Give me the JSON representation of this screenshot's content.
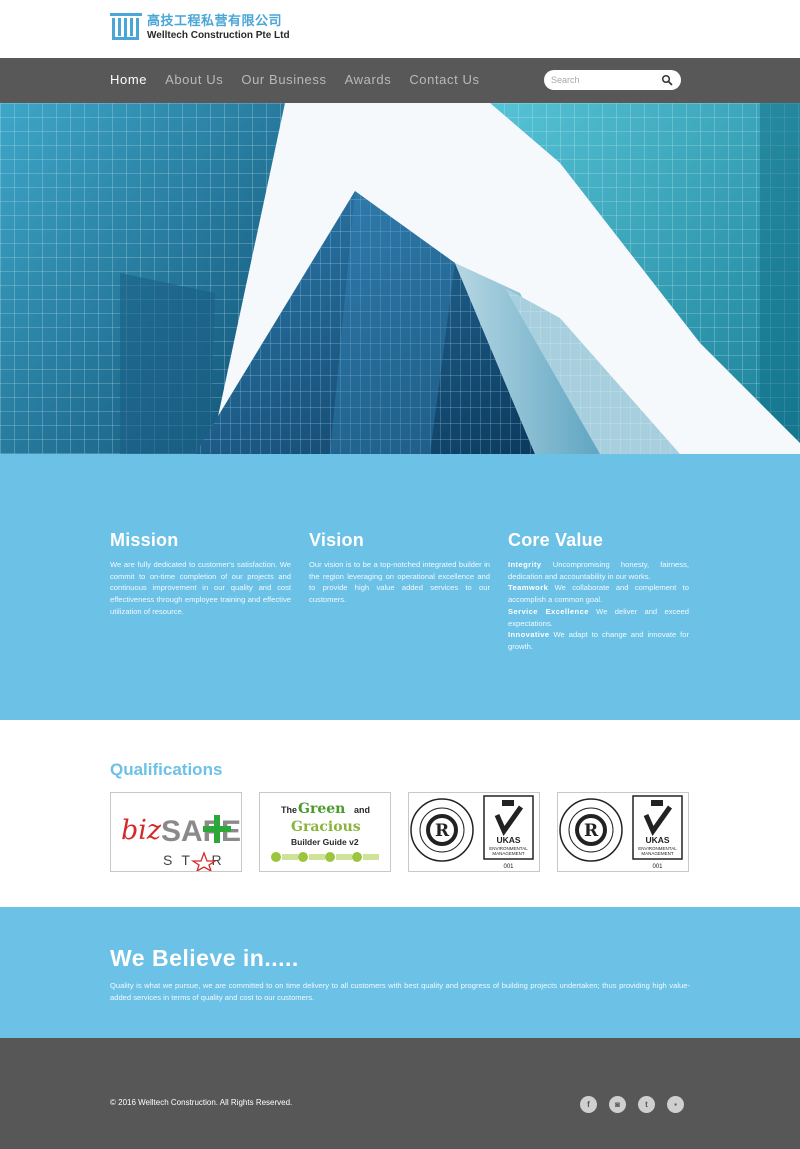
{
  "brand": {
    "name_cn": "高技工程私营有限公司",
    "name_en": "Welltech Construction Pte Ltd",
    "color_primary": "#4aa6d6"
  },
  "nav": {
    "items": [
      {
        "label": "Home",
        "active": true
      },
      {
        "label": "About Us",
        "active": false
      },
      {
        "label": "Our Business",
        "active": false
      },
      {
        "label": "Awards",
        "active": false
      },
      {
        "label": "Contact Us",
        "active": false
      }
    ],
    "search_placeholder": "Search",
    "search_icon": "search-icon"
  },
  "hero": {
    "image": "glass skyscrapers viewed from below"
  },
  "mission": {
    "title": "Mission",
    "text": "We are fully dedicated to customer's satisfaction. We commit to on-time completion of our projects and continuous improvement in our quality and cost effectiveness through employee training and effective utilization of resource."
  },
  "vision": {
    "title": "Vision",
    "text": "Our vision is to be a top-notched integrated builder in the region leveraging on operational excellence and to provide high value added services to our customers."
  },
  "core_value": {
    "title": "Core Value",
    "items": [
      {
        "term": "Integrity",
        "desc": "Uncompromising honesty, fairness, dedication and accountability in our works."
      },
      {
        "term": "Teamwork",
        "desc": "We collaborate and complement to accomplish a common goal."
      },
      {
        "term": "Service Excellence",
        "desc": "We deliver and exceed expectations."
      },
      {
        "term": "Innovative",
        "desc": "We adapt to change and innovate for growth."
      }
    ]
  },
  "qualifications": {
    "title": "Qualifications",
    "certs": [
      {
        "name": "bizSAFE Star",
        "text_biz": "biz",
        "text_safe": "SAFE",
        "text_star": "ST  R"
      },
      {
        "name": "Green and Gracious Builder Guide v2",
        "text_the": "The",
        "text_green": "Green",
        "text_and": "and",
        "text_gracious": "Gracious",
        "text_guide": "Builder Guide v2"
      },
      {
        "name": "UKAS ISO 14001",
        "text_ukas": "UKAS",
        "text_env": "ENVIRONMENTAL",
        "text_mgmt": "MANAGEMENT",
        "text_num": "001"
      },
      {
        "name": "UKAS ISO 14001",
        "text_ukas": "UKAS",
        "text_env": "ENVIRONMENTAL",
        "text_mgmt": "MANAGEMENT",
        "text_num": "001"
      }
    ]
  },
  "believe": {
    "title": "We Believe in.....",
    "text": "Quality is what we pursue, we are committed to on time delivery to all customers with best quality and progress of building projects undertaken; thus providing high value-added services in terms of quality and cost to our customers."
  },
  "footer": {
    "copyright": "© 2016 Welltech Construction. All Rights Reserved.",
    "socials": [
      {
        "name": "facebook-icon",
        "glyph": "f"
      },
      {
        "name": "instagram-icon",
        "glyph": "◙"
      },
      {
        "name": "twitter-icon",
        "glyph": "t"
      },
      {
        "name": "flickr-icon",
        "glyph": "▪"
      }
    ]
  },
  "colors": {
    "band": "#6cc1e6",
    "nav": "#585858",
    "footer": "#575757"
  }
}
